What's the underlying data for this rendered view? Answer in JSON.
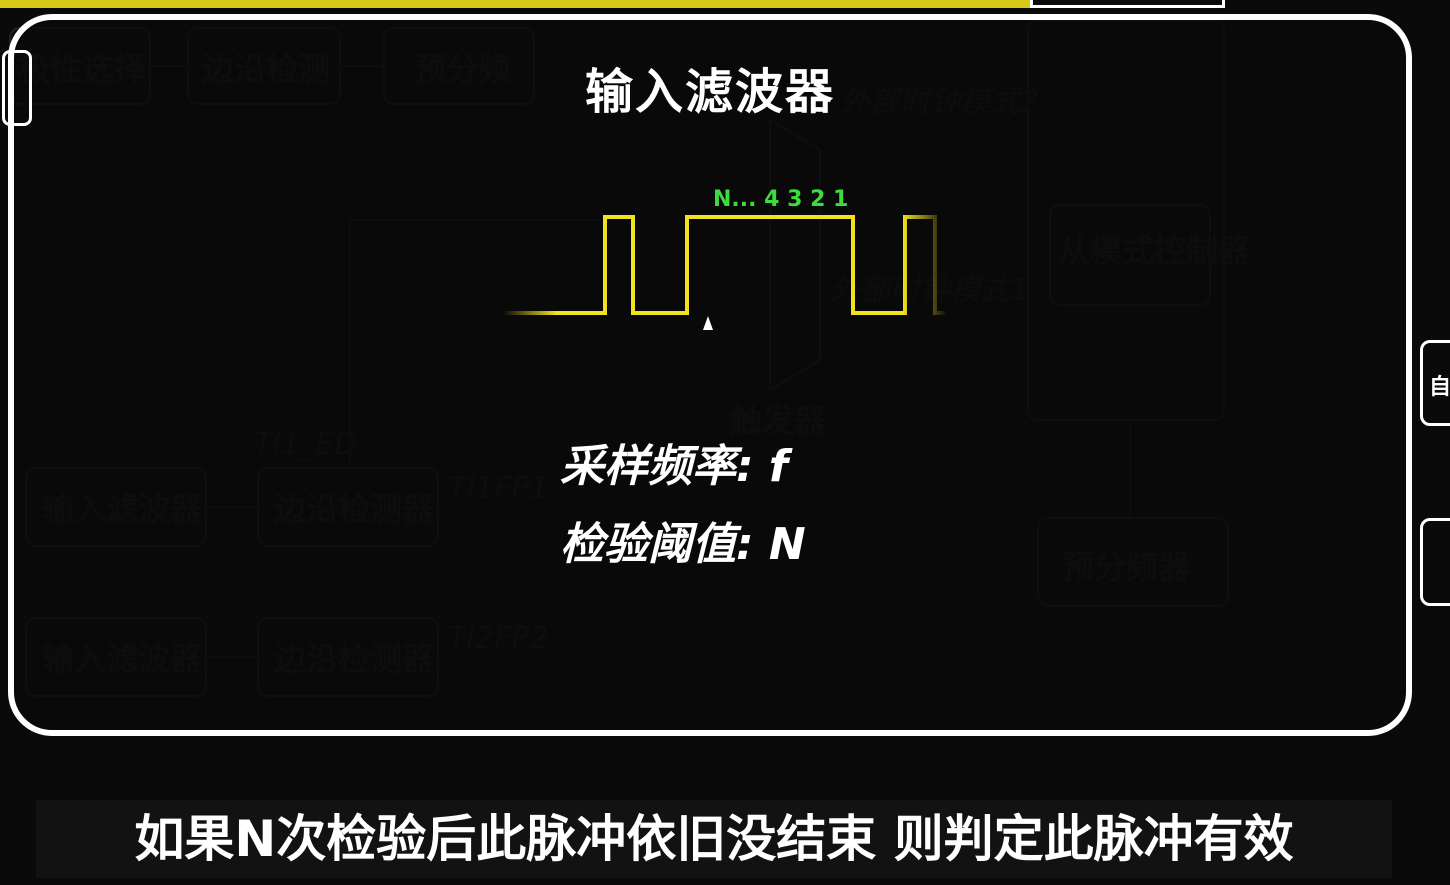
{
  "title": "输入滤波器",
  "waveform": {
    "counter_label": "N... 4 3 2 1",
    "signal_color": "#f2e21d",
    "counter_color": "#3ddc3d"
  },
  "params": {
    "sampling_rate": "采样频率: f",
    "threshold": "检验阈值: N"
  },
  "subtitle": "如果N次检验后此脉冲依旧没结束 则判定此脉冲有效",
  "side_tab_label": "自",
  "colors": {
    "panel_border": "#ffffff",
    "background": "#0a0a0a",
    "accent_bar": "#d8c81a"
  }
}
